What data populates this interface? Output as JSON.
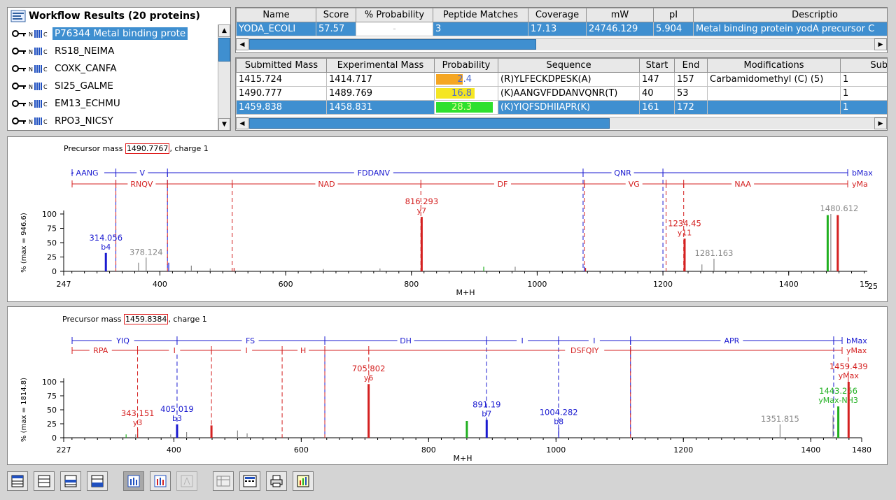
{
  "tree": {
    "title": "Workflow Results (20 proteins)",
    "items": [
      {
        "label": "P76344 Metal binding prote",
        "selected": true
      },
      {
        "label": "RS18_NEIMA",
        "selected": false
      },
      {
        "label": "COXK_CANFA",
        "selected": false
      },
      {
        "label": "SI25_GALME",
        "selected": false
      },
      {
        "label": "EM13_ECHMU",
        "selected": false
      },
      {
        "label": "RPO3_NICSY",
        "selected": false
      }
    ]
  },
  "protein_table": {
    "columns": [
      "Name",
      "Score",
      "% Probability",
      "Peptide Matches",
      "Coverage",
      "mW",
      "pI",
      "Descriptio"
    ],
    "row": [
      "YODA_ECOLI",
      "57.57",
      "-",
      "3",
      "17.13",
      "24746.129",
      "5.904",
      "Metal binding protein yodA precursor  C"
    ]
  },
  "peptide_table": {
    "columns": [
      "Submitted Mass",
      "Experimental Mass",
      "Probability",
      "Sequence",
      "Start",
      "End",
      "Modifications",
      "Submitt"
    ],
    "rows": [
      {
        "submitted": "1415.724",
        "experimental": "1414.717",
        "probability": "2.4",
        "bar_color": "#f5a623",
        "bar_fraction": 0.45,
        "sequence": "(R)YLFECKDPESK(A)",
        "start": "147",
        "end": "157",
        "mods": "Carbamidomethyl (C) (5)",
        "sub": "1",
        "selected": false
      },
      {
        "submitted": "1490.777",
        "experimental": "1489.769",
        "probability": "16.8",
        "bar_color": "#f5e623",
        "bar_fraction": 0.65,
        "sequence": "(K)AANGVFDDANVQNR(T)",
        "start": "40",
        "end": "53",
        "mods": "",
        "sub": "1",
        "selected": false
      },
      {
        "submitted": "1459.838",
        "experimental": "1458.831",
        "probability": "28.3",
        "bar_color": "#2ee02e",
        "bar_fraction": 0.95,
        "sequence": "(K)YIQFSDHIIAPR(K)",
        "start": "161",
        "end": "172",
        "mods": "",
        "sub": "1",
        "selected": true
      }
    ]
  },
  "spectra": [
    {
      "precursor_prefix": "Precursor mass ",
      "precursor_value": "1490.7767",
      "precursor_suffix": ", charge 1",
      "xmin": 247,
      "xmax": 1525,
      "xticks": [
        247,
        400,
        600,
        800,
        1000,
        1200,
        1400
      ],
      "xtick_labels": [
        "247",
        "400",
        "600",
        "800",
        "1000",
        "1200",
        "1400"
      ],
      "xmax_label_a": "15",
      "xmax_label_b": "25",
      "yticks": [
        0,
        25,
        50,
        75,
        100
      ],
      "ylabel": "% (max = 946.6)",
      "xlabel": "M+H",
      "b_ladder": {
        "start_label": "- AANG",
        "end_label": "bMax",
        "cuts": [
          330,
          412,
          1073,
          1200
        ],
        "segments": [
          {
            "x": 372,
            "t": "V"
          },
          {
            "x": 740,
            "t": "FDDANV"
          },
          {
            "x": 1136,
            "t": "QNR"
          }
        ]
      },
      "y_ladder": {
        "end_label": "yMa",
        "cuts": [
          330,
          412,
          515,
          815,
          1075,
          1233,
          1205
        ],
        "segments": [
          {
            "x": 371,
            "t": "RNQV"
          },
          {
            "x": 665,
            "t": "NAD"
          },
          {
            "x": 945,
            "t": "DF"
          },
          {
            "x": 1154,
            "t": "VG"
          },
          {
            "x": 1327,
            "t": "NAA"
          }
        ]
      },
      "peaks": [
        {
          "x": 314.056,
          "h": 32,
          "c": "#1a1ad0",
          "label": "314.056",
          "sub": "b4"
        },
        {
          "x": 366,
          "h": 15,
          "c": "#888888"
        },
        {
          "x": 378.124,
          "h": 24,
          "c": "#888888",
          "label": "378.124"
        },
        {
          "x": 414,
          "h": 15,
          "c": "#1a1ad0"
        },
        {
          "x": 450,
          "h": 10,
          "c": "#888888"
        },
        {
          "x": 480,
          "h": 5,
          "c": "#888888"
        },
        {
          "x": 518,
          "h": 6,
          "c": "#d42020"
        },
        {
          "x": 660,
          "h": 4,
          "c": "#888888"
        },
        {
          "x": 750,
          "h": 5,
          "c": "#888888"
        },
        {
          "x": 816.293,
          "h": 95,
          "c": "#d42020",
          "label": "816.293",
          "sub": "y7"
        },
        {
          "x": 915,
          "h": 8,
          "c": "#20b020"
        },
        {
          "x": 965,
          "h": 8,
          "c": "#888888"
        },
        {
          "x": 1075,
          "h": 8,
          "c": "#1a1ad0"
        },
        {
          "x": 1077,
          "h": 6,
          "c": "#d42020"
        },
        {
          "x": 1234.45,
          "h": 57,
          "c": "#d42020",
          "label": "1234.45",
          "sub": "y11"
        },
        {
          "x": 1262,
          "h": 12,
          "c": "#888888"
        },
        {
          "x": 1281.163,
          "h": 22,
          "c": "#888888",
          "label": "1281.163"
        },
        {
          "x": 1462,
          "h": 98,
          "c": "#20b020"
        },
        {
          "x": 1467,
          "h": 100,
          "c": "#888888",
          "label": "1480.612"
        },
        {
          "x": 1478,
          "h": 98,
          "c": "#d42020"
        }
      ]
    },
    {
      "precursor_prefix": "Precursor mass ",
      "precursor_value": "1459.8384",
      "precursor_suffix": ", charge 1",
      "xmin": 227,
      "xmax": 1480,
      "xticks": [
        227,
        400,
        600,
        800,
        1000,
        1200,
        1400,
        1480
      ],
      "xtick_labels": [
        "227",
        "400",
        "600",
        "800",
        "1000",
        "1200",
        "1400",
        "1480"
      ],
      "yticks": [
        0,
        25,
        50,
        75,
        100
      ],
      "ylabel": "% (max = 1814.8)",
      "xlabel": "M+H",
      "b_ladder": {
        "start_label": "",
        "end_label": "bMax",
        "cuts": [
          405,
          637,
          891,
          1004,
          1117,
          1436
        ],
        "segments": [
          {
            "x": 320,
            "t": "YIQ"
          },
          {
            "x": 520,
            "t": "FS"
          },
          {
            "x": 764,
            "t": "DH"
          },
          {
            "x": 947,
            "t": "I"
          },
          {
            "x": 1060,
            "t": "I"
          },
          {
            "x": 1276,
            "t": "APR"
          }
        ]
      },
      "y_ladder": {
        "end_label": "yMax",
        "cuts": [
          343,
          459,
          570,
          637,
          706,
          1117,
          1459
        ],
        "segments": [
          {
            "x": 285,
            "t": "RPA"
          },
          {
            "x": 401,
            "t": "I"
          },
          {
            "x": 514,
            "t": "I"
          },
          {
            "x": 603,
            "t": "H"
          },
          {
            "x": 1045,
            "t": "DSFQIY"
          }
        ]
      },
      "peaks": [
        {
          "x": 325,
          "h": 6,
          "c": "#20b020"
        },
        {
          "x": 340,
          "h": 6,
          "c": "#888888"
        },
        {
          "x": 343.151,
          "h": 16,
          "c": "#d42020",
          "label": "343.151",
          "sub": "y3"
        },
        {
          "x": 395,
          "h": 6,
          "c": "#888888"
        },
        {
          "x": 405.019,
          "h": 24,
          "c": "#1a1ad0",
          "label": "405.019",
          "sub": "b3"
        },
        {
          "x": 420,
          "h": 10,
          "c": "#888888"
        },
        {
          "x": 459,
          "h": 22,
          "c": "#d42020"
        },
        {
          "x": 500,
          "h": 13,
          "c": "#888888"
        },
        {
          "x": 515,
          "h": 8,
          "c": "#888888"
        },
        {
          "x": 705.802,
          "h": 96,
          "c": "#d42020",
          "label": "705.802",
          "sub": "y6"
        },
        {
          "x": 860,
          "h": 30,
          "c": "#20b020"
        },
        {
          "x": 891.19,
          "h": 32,
          "c": "#1a1ad0",
          "label": "891.19",
          "sub": "b7"
        },
        {
          "x": 1004.282,
          "h": 18,
          "c": "#1a1ad0",
          "label": "1004.282",
          "sub": "b8"
        },
        {
          "x": 1351.815,
          "h": 24,
          "c": "#888888",
          "label": "1351.815"
        },
        {
          "x": 1435,
          "h": 40,
          "c": "#888888"
        },
        {
          "x": 1443.256,
          "h": 56,
          "c": "#20b020",
          "label": "1443.256",
          "sub": "yMax-NH3"
        },
        {
          "x": 1459.439,
          "h": 100,
          "c": "#d42020",
          "label": "1459.439",
          "sub": "yMax"
        }
      ]
    }
  ],
  "toolbar": {
    "buttons": [
      "layout-1-icon",
      "layout-2-icon",
      "layout-3-icon",
      "layout-4-icon",
      "spectrum-view-icon",
      "spectrum-compare-icon",
      "fragment-icon",
      "table-export-icon",
      "keyboard-icon",
      "print-icon",
      "chart-export-icon"
    ]
  }
}
